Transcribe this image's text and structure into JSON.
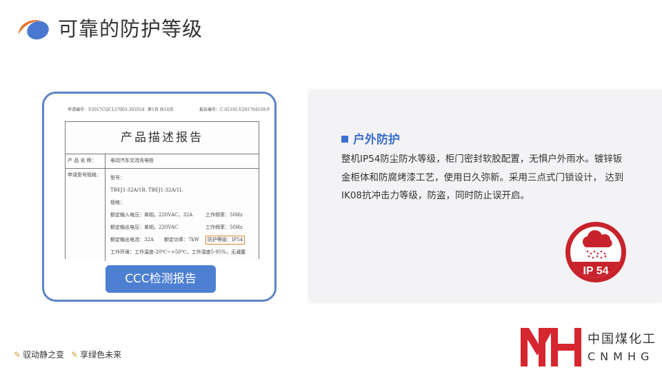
{
  "title": "可靠的防护等级",
  "report": {
    "meta_left": "申请编号：V2017CQC127003-303554",
    "meta_mid": "第1页 共14页",
    "meta_right": "报告编号：C-02101-V201704559-P",
    "doc_title": "产品描述报告",
    "product_label": "产 品 名 称：",
    "product_value": "电动汽车交流充电桩",
    "model_label": "申请型号规格：",
    "model_heading": "型号：",
    "model_value": "TBEJ1-32A/1B, TBEJ1-32A/1L",
    "spec_heading": "规格：",
    "spec_input_v": "额定输入电压：单相，220VAC，32A",
    "spec_freq_1": "工作频率：50Hz",
    "spec_output_v": "额定输出电压：单相，220VAC",
    "spec_freq_2": "工作频率：50Hz",
    "spec_output_i": "额定输出电流：32A",
    "spec_power": "额定功率：7kW",
    "spec_protection": "防护等级：IP54",
    "spec_env": "工作环境：工作温度-20℃~+50℃，工作湿度5-95%，无凝露",
    "button_label": "CCC检测报告"
  },
  "info": {
    "heading": "户外防护",
    "body": "整机IP54防尘防水等级，柜门密封软胶配置，无惧户外雨水。镀锌钣金柜体和防腐烤漆工艺，使用日久弥新。采用三点式门锁设计， 达到IK08抗冲击力等级，防盗，同时防止误开启。",
    "badge_text": "IP 54"
  },
  "footer": {
    "slogan_1": "驭动静之变",
    "slogan_2": "享绿色未来",
    "brand_cn": "中国煤化工",
    "brand_en": "CNMHG"
  },
  "colors": {
    "accent_blue": "#3a6fd0",
    "button_blue": "#4d7fd2",
    "badge_red": "#c8232c",
    "logo_red": "#d6262f",
    "highlight_orange": "#e08a2c"
  }
}
